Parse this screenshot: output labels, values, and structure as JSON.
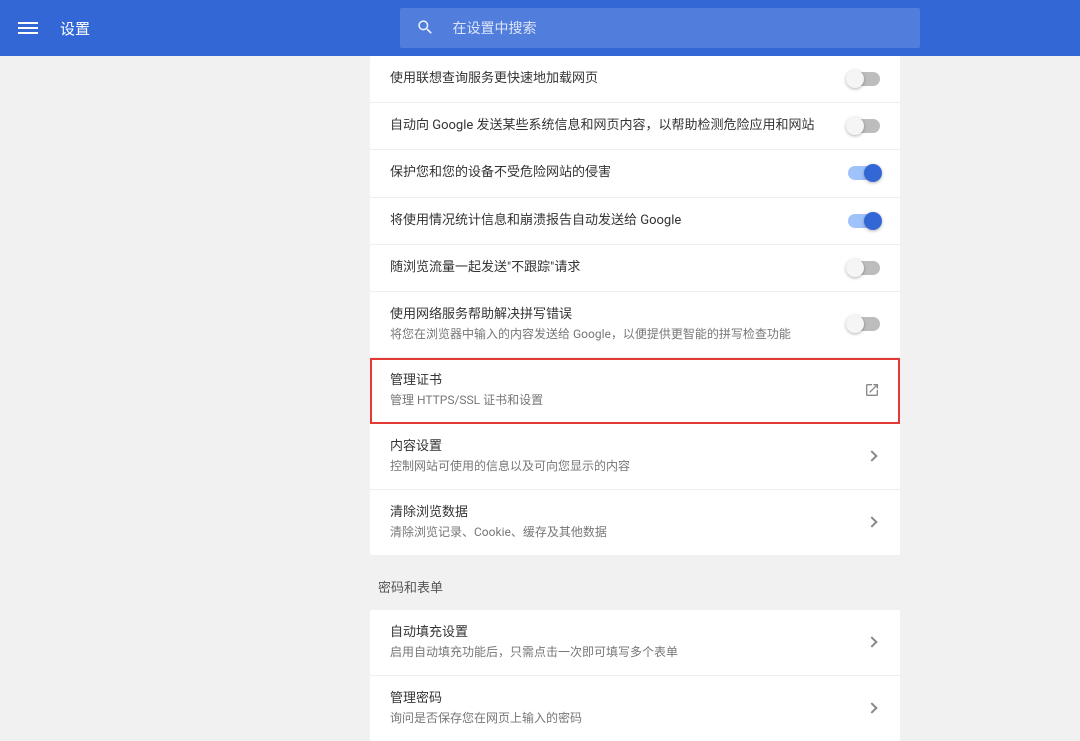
{
  "header": {
    "title": "设置",
    "search_placeholder": "在设置中搜索"
  },
  "privacy": {
    "items": [
      {
        "title": "使用联想查询服务更快速地加载网页",
        "subtitle": null,
        "control": "toggle",
        "on": false
      },
      {
        "title": "自动向 Google 发送某些系统信息和网页内容，以帮助检测危险应用和网站",
        "subtitle": null,
        "control": "toggle",
        "on": false
      },
      {
        "title": "保护您和您的设备不受危险网站的侵害",
        "subtitle": null,
        "control": "toggle",
        "on": true
      },
      {
        "title": "将使用情况统计信息和崩溃报告自动发送给 Google",
        "subtitle": null,
        "control": "toggle",
        "on": true
      },
      {
        "title": "随浏览流量一起发送\"不跟踪\"请求",
        "subtitle": null,
        "control": "toggle",
        "on": false
      },
      {
        "title": "使用网络服务帮助解决拼写错误",
        "subtitle": "将您在浏览器中输入的内容发送给 Google，以便提供更智能的拼写检查功能",
        "control": "toggle",
        "on": false
      },
      {
        "title": "管理证书",
        "subtitle": "管理 HTTPS/SSL 证书和设置",
        "control": "external",
        "highlighted": true
      },
      {
        "title": "内容设置",
        "subtitle": "控制网站可使用的信息以及可向您显示的内容",
        "control": "arrow"
      },
      {
        "title": "清除浏览数据",
        "subtitle": "清除浏览记录、Cookie、缓存及其他数据",
        "control": "arrow"
      }
    ]
  },
  "passwords": {
    "section_label": "密码和表单",
    "items": [
      {
        "title": "自动填充设置",
        "subtitle": "启用自动填充功能后，只需点击一次即可填写多个表单",
        "control": "arrow"
      },
      {
        "title": "管理密码",
        "subtitle": "询问是否保存您在网页上输入的密码",
        "control": "arrow"
      }
    ]
  }
}
